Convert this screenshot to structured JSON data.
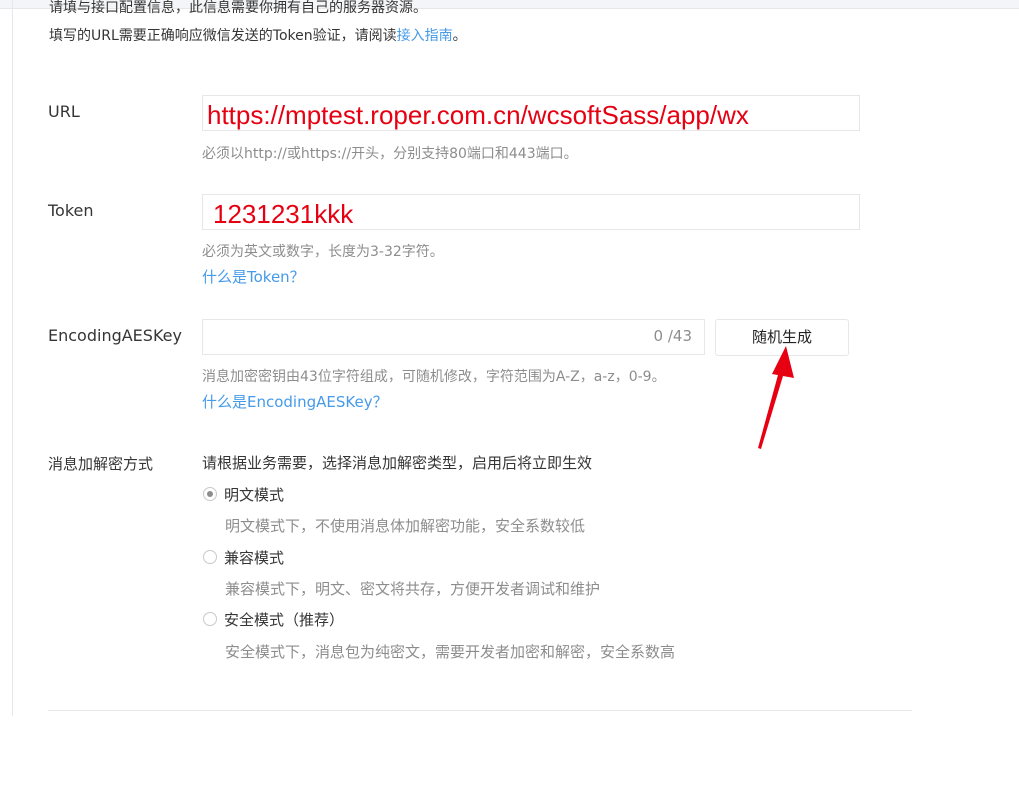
{
  "intro": {
    "line1": "请填与接口配置信息，此信息需要你拥有自己的服务器资源。",
    "line2_prefix": "填写的URL需要正确响应微信发送的Token验证，请阅读",
    "line2_link": "接入指南",
    "line2_suffix": "。"
  },
  "url": {
    "label": "URL",
    "value": "https://mptest.roper.com.cn/wcsoftSass/app/wx",
    "hint": "必须以http://或https://开头，分别支持80端口和443端口。"
  },
  "token": {
    "label": "Token",
    "value": "1231231kkk",
    "hint": "必须为英文或数字，长度为3-32字符。",
    "help_link": "什么是Token？"
  },
  "aes": {
    "label": "EncodingAESKey",
    "value": "",
    "counter": "0 /43",
    "button": "随机生成",
    "hint": "消息加密密钥由43位字符组成，可随机修改，字符范围为A-Z，a-z，0-9。",
    "help_link": "什么是EncodingAESKey？"
  },
  "encryption": {
    "label": "消息加解密方式",
    "description": "请根据业务需要，选择消息加解密类型，启用后将立即生效",
    "options": [
      {
        "label": "明文模式",
        "desc": "明文模式下，不使用消息体加解密功能，安全系数较低",
        "checked": true
      },
      {
        "label": "兼容模式",
        "desc": "兼容模式下，明文、密文将共存，方便开发者调试和维护",
        "checked": false
      },
      {
        "label": "安全模式（推荐）",
        "desc": "安全模式下，消息包为纯密文，需要开发者加密和解密，安全系数高",
        "checked": false
      }
    ]
  },
  "colors": {
    "annotation_red": "#e60012",
    "link_blue": "#459ae9",
    "hint_gray": "#8d8d8d"
  }
}
